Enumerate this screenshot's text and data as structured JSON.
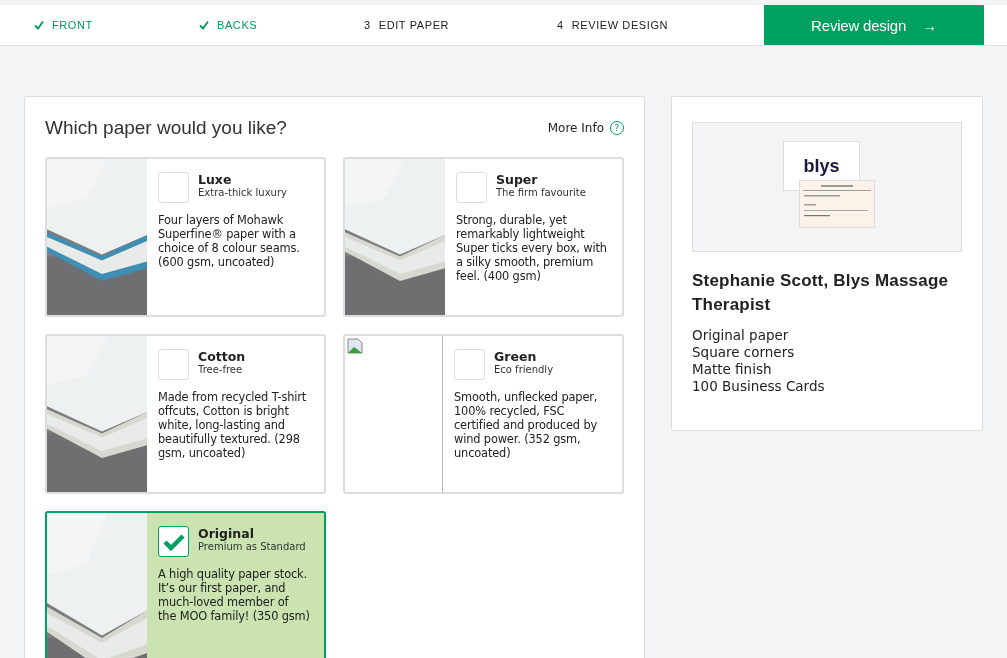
{
  "steps": [
    {
      "label": "FRONT",
      "done": true
    },
    {
      "label": "BACKS",
      "done": true
    },
    {
      "number": "3",
      "label": "EDIT PAPER",
      "done": false
    },
    {
      "number": "4",
      "label": "REVIEW DESIGN",
      "done": false
    }
  ],
  "next_button": {
    "label": "Review design",
    "arrow": "→"
  },
  "paper_panel": {
    "title": "Which paper would you like?",
    "more_info": "More Info",
    "help": "?",
    "papers": [
      {
        "name": "Luxe",
        "tagline": "Extra-thick luxury",
        "description": "Four layers of Mohawk Superfine® paper with a choice of 8 colour seams. (600 gsm, uncoated)",
        "selected": false,
        "kind": "picture"
      },
      {
        "name": "Super",
        "tagline": "The firm favourite",
        "description": "Strong, durable, yet remarkably lightweight Super ticks every box, with a silky smooth, premium feel. (400 gsm)",
        "selected": false,
        "kind": "picture"
      },
      {
        "name": "Cotton",
        "tagline": "Tree-free",
        "description": "Made from recycled T-shirt offcuts, Cotton is bright white, long-lasting and beautifully textured. (298 gsm, uncoated)",
        "selected": false,
        "kind": "picture"
      },
      {
        "name": "Green",
        "tagline": "Eco friendly",
        "description": "Smooth, unflecked paper, 100% recycled, FSC certified and produced by wind power. (352 gsm, uncoated)",
        "selected": false,
        "kind": "broken"
      },
      {
        "name": "Original",
        "tagline": "Premium as Standard",
        "description": "A high quality paper stock. It’s our first paper, and much-loved member of the MOO family! (350 gsm)",
        "selected": true,
        "kind": "picture"
      }
    ]
  },
  "summary": {
    "preview": {
      "logo": "blys"
    },
    "title": "Stephanie Scott, Blys Massage Therapist",
    "details": [
      "Original paper",
      "Square corners",
      "Matte finish",
      "100 Business Cards"
    ]
  }
}
